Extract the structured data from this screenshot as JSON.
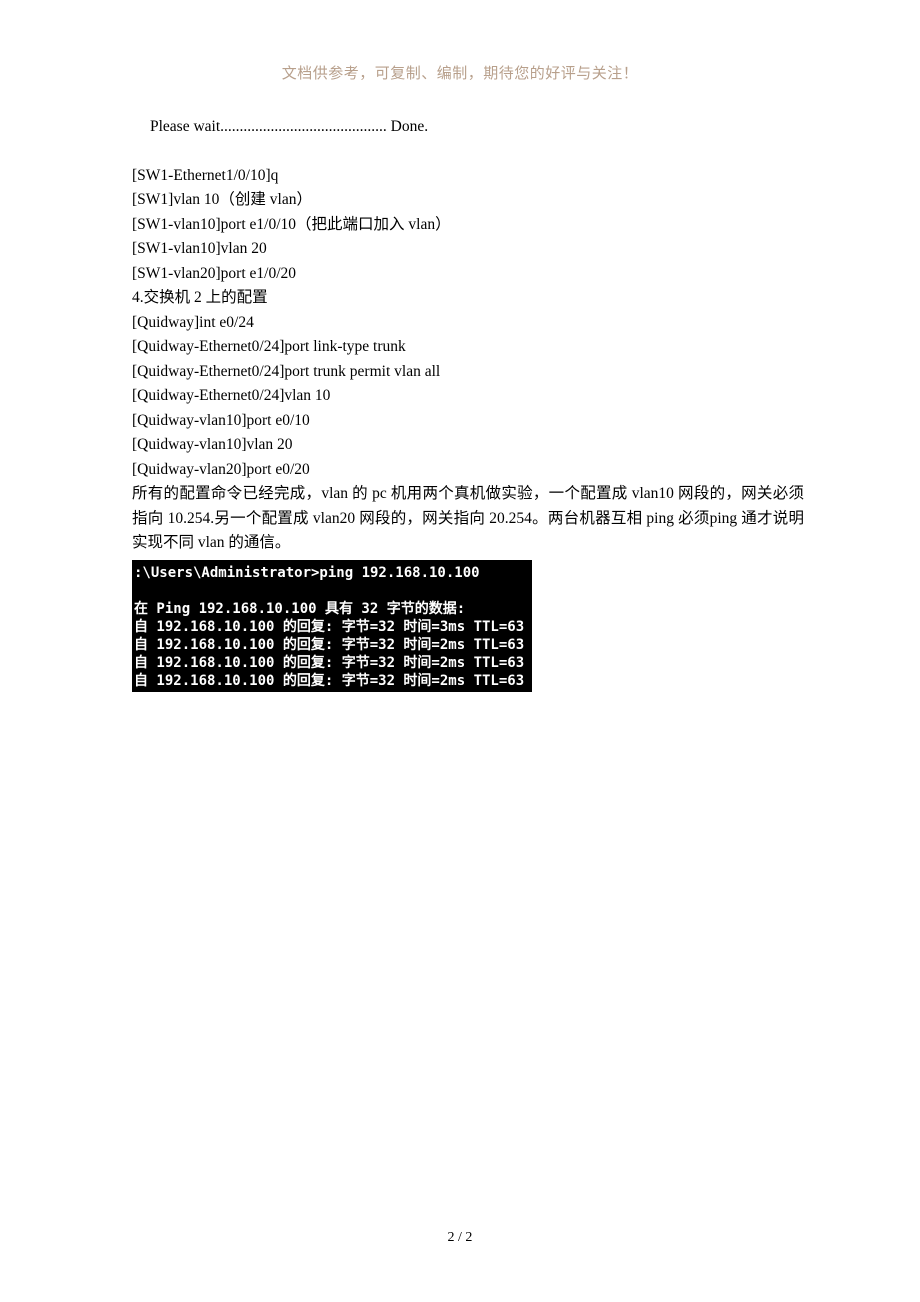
{
  "header": {
    "note": "文档供参考，可复制、编制，期待您的好评与关注！"
  },
  "body": {
    "l1": "Please wait........................................... Done.",
    "l2": "[SW1-Ethernet1/0/10]q",
    "l3": "[SW1]vlan 10（创建 vlan）",
    "l4": "[SW1-vlan10]port e1/0/10（把此端口加入 vlan）",
    "l5": "[SW1-vlan10]vlan 20",
    "l6": "[SW1-vlan20]port e1/0/20",
    "l7": "4.交换机 2 上的配置",
    "l8": "[Quidway]int e0/24",
    "l9": "[Quidway-Ethernet0/24]port link-type trunk",
    "l10": "[Quidway-Ethernet0/24]port trunk permit vlan all",
    "l11": "[Quidway-Ethernet0/24]vlan 10",
    "l12": "[Quidway-vlan10]port e0/10",
    "l13": "[Quidway-vlan10]vlan 20",
    "l14": "[Quidway-vlan20]port e0/20",
    "para": "所有的配置命令已经完成，vlan 的 pc 机用两个真机做实验，一个配置成 vlan10 网段的，网关必须指向 10.254.另一个配置成 vlan20 网段的，网关指向 20.254。两台机器互相 ping 必须ping 通才说明实现不同 vlan 的通信。"
  },
  "terminal": {
    "t1": ":\\Users\\Administrator>ping 192.168.10.100",
    "t2": "在 Ping 192.168.10.100 具有 32 字节的数据:",
    "t3": "自 192.168.10.100 的回复: 字节=32 时间=3ms TTL=63",
    "t4": "自 192.168.10.100 的回复: 字节=32 时间=2ms TTL=63",
    "t5": "自 192.168.10.100 的回复: 字节=32 时间=2ms TTL=63",
    "t6": "自 192.168.10.100 的回复: 字节=32 时间=2ms TTL=63"
  },
  "footer": {
    "page": "2 / 2"
  }
}
